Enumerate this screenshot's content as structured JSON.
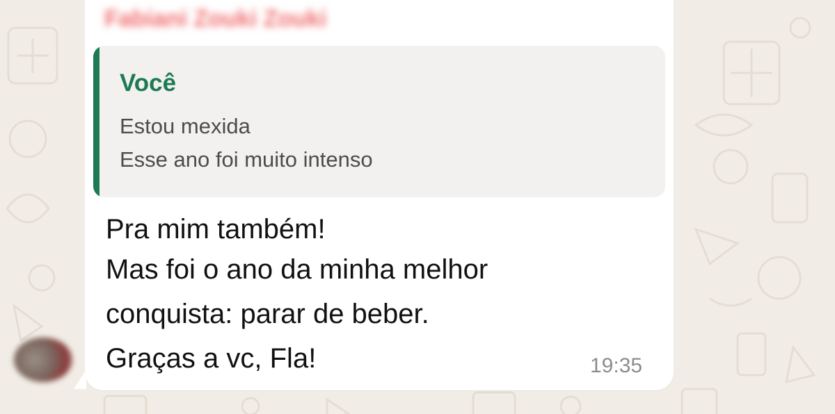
{
  "contact": {
    "sender_name": "Fabiani Zouki Zouki"
  },
  "quoted_message": {
    "author": "Você",
    "lines": [
      "Estou mexida",
      "Esse ano foi muito intenso"
    ]
  },
  "message": {
    "lines": [
      "Pra mim também!",
      "Mas foi o ano da minha melhor",
      "conquista: parar de beber.",
      "Graças a vc, Fla!"
    ],
    "time": "19:35"
  },
  "colors": {
    "sender_name": "#f06f70",
    "quote_accent": "#1d7a53",
    "chat_background": "#f1ede6",
    "bubble": "#ffffff"
  }
}
